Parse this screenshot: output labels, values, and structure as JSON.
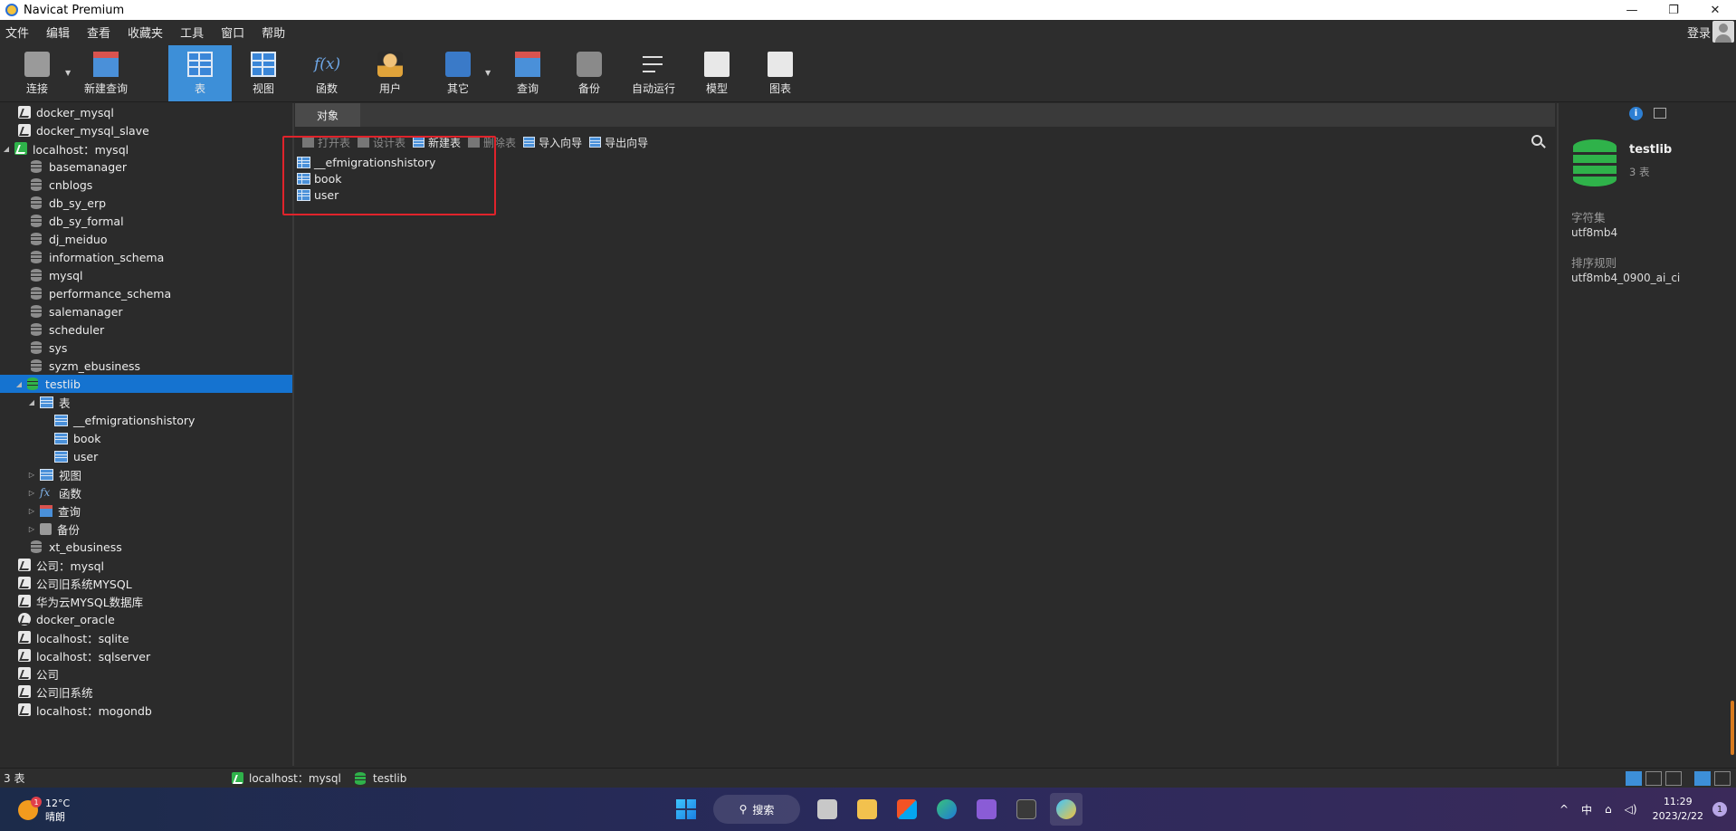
{
  "window": {
    "title": "Navicat Premium",
    "controls": [
      "—",
      "❐",
      "✕"
    ]
  },
  "menu": {
    "items": [
      "文件",
      "编辑",
      "查看",
      "收藏夹",
      "工具",
      "窗口",
      "帮助"
    ],
    "login": "登录"
  },
  "toolbar": {
    "tools": [
      {
        "label": "连接",
        "icon": "plug-icon"
      },
      {
        "label": "新建查询",
        "icon": "new-query-icon"
      },
      {
        "label": "表",
        "icon": "table-icon",
        "active": true
      },
      {
        "label": "视图",
        "icon": "view-icon"
      },
      {
        "label": "函数",
        "icon": "function-icon",
        "glyph": "f(x)"
      },
      {
        "label": "用户",
        "icon": "user-icon"
      },
      {
        "label": "其它",
        "icon": "tools-icon"
      },
      {
        "label": "查询",
        "icon": "query-icon"
      },
      {
        "label": "备份",
        "icon": "backup-icon"
      },
      {
        "label": "自动运行",
        "icon": "schedule-icon"
      },
      {
        "label": "模型",
        "icon": "model-icon"
      },
      {
        "label": "图表",
        "icon": "chart-icon"
      }
    ]
  },
  "content": {
    "tab": "对象",
    "object_toolbar": {
      "open_table": "打开表",
      "design_table": "设计表",
      "new_table": "新建表",
      "delete_table": "删除表",
      "import_wizard": "导入向导",
      "export_wizard": "导出向导"
    },
    "objects": [
      "__efmigrationshistory",
      "book",
      "user"
    ]
  },
  "sidebar": {
    "connections_top": [
      "docker_mysql",
      "docker_mysql_slave"
    ],
    "active_connection": "localhost：mysql",
    "databases": [
      "basemanager",
      "cnblogs",
      "db_sy_erp",
      "db_sy_formal",
      "dj_meiduo",
      "information_schema",
      "mysql",
      "performance_schema",
      "salemanager",
      "scheduler",
      "sys",
      "syzm_ebusiness"
    ],
    "selected_db": "testlib",
    "tables_group": "表",
    "tables": [
      "__efmigrationshistory",
      "book",
      "user"
    ],
    "groups": {
      "views": "视图",
      "functions": "函数",
      "queries": "查询",
      "backups": "备份"
    },
    "fx_glyph": "fx",
    "after_db": "xt_ebusiness",
    "connections_bottom": [
      "公司：mysql",
      "公司旧系统MYSQL",
      "华为云MYSQL数据库",
      "docker_oracle",
      "localhost：sqlite",
      "localhost：sqlserver",
      "公司",
      "公司旧系统",
      "localhost：mogondb"
    ]
  },
  "inspector": {
    "info_glyph": "i",
    "name": "testlib",
    "count": "3 表",
    "charset_label": "字符集",
    "charset_value": "utf8mb4",
    "collation_label": "排序规则",
    "collation_value": "utf8mb4_0900_ai_ci"
  },
  "statusbar": {
    "count": "3 表",
    "connection": "localhost：mysql",
    "database": "testlib"
  },
  "taskbar": {
    "temperature": "12°C",
    "weather": "晴朗",
    "weather_badge": "1",
    "search": "搜索",
    "search_glyph": "⚲",
    "ime": "中",
    "tray_up": "^",
    "tray_net": "⌂",
    "tray_vol": "◁)",
    "time": "11:29",
    "date": "2023/2/22",
    "notifications": "1"
  }
}
